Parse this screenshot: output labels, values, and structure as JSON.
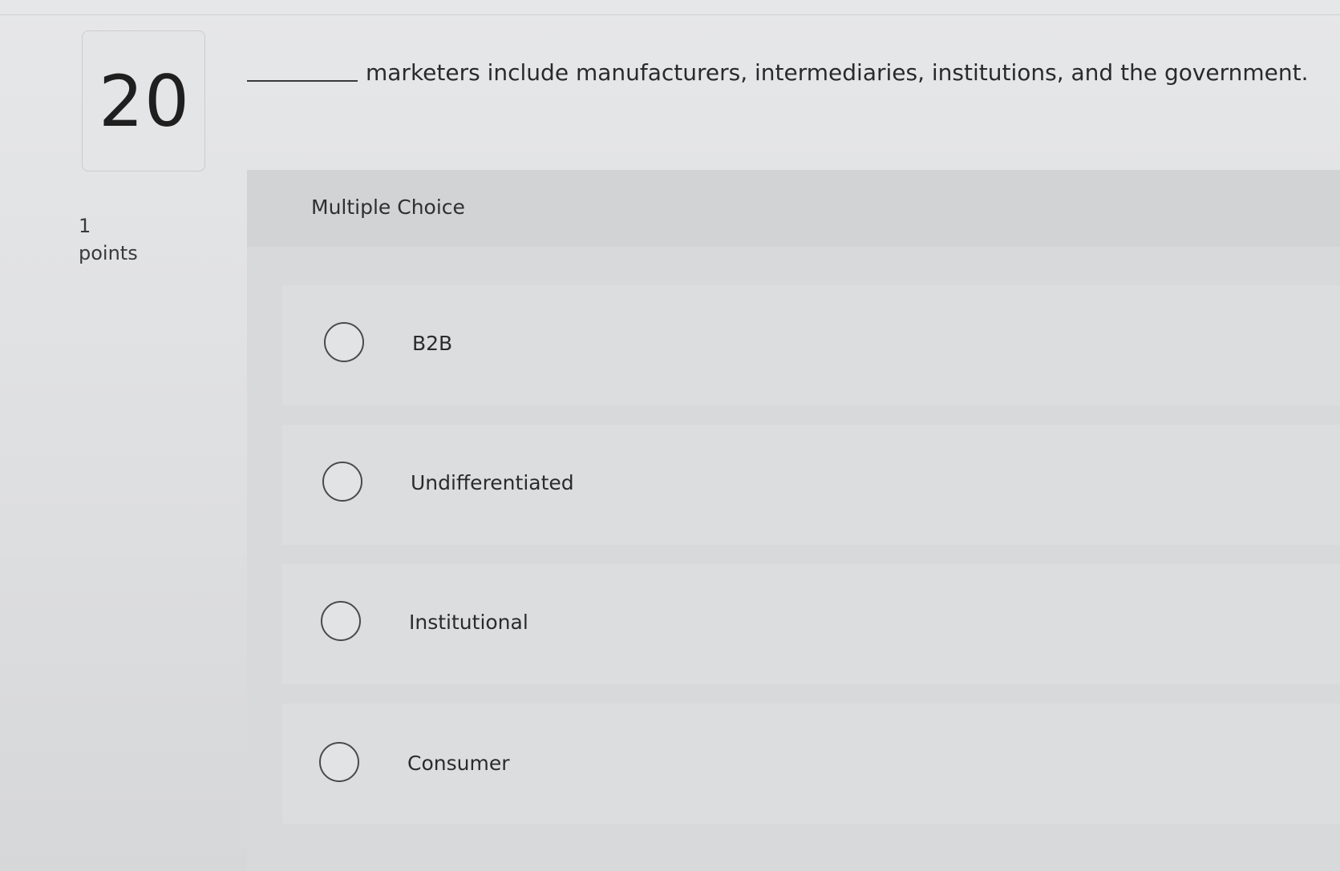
{
  "question": {
    "number": "20",
    "points_value": "1",
    "points_label": "points",
    "prompt": "marketers include manufacturers, intermediaries, institutions, and the government."
  },
  "answer_type": "Multiple Choice",
  "options": [
    {
      "label": "B2B",
      "selected": false
    },
    {
      "label": "Undifferentiated",
      "selected": false
    },
    {
      "label": "Institutional",
      "selected": false
    },
    {
      "label": "Consumer",
      "selected": false
    }
  ]
}
